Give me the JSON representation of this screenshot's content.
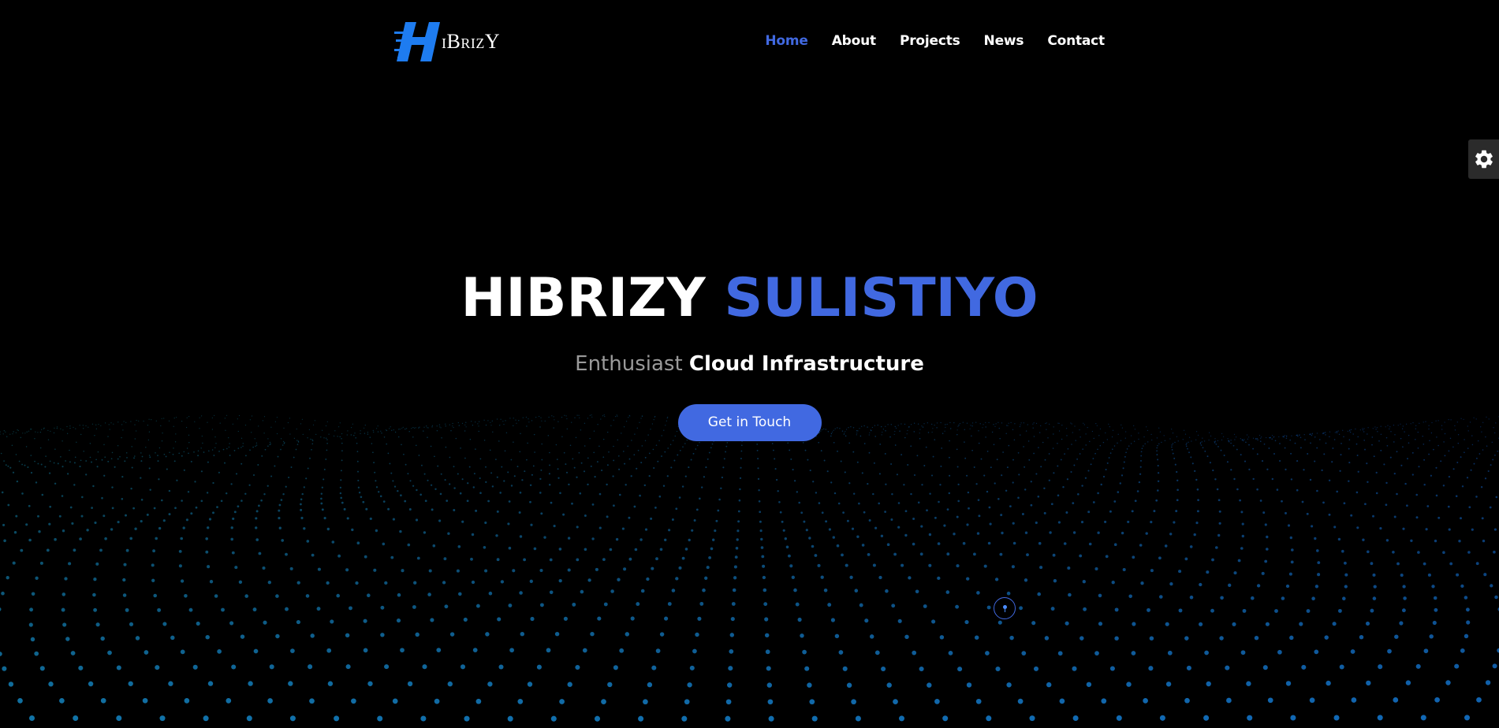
{
  "brand": {
    "logo_text": "iBrizY",
    "logo_letter": "H",
    "accent_color": "#4169e1"
  },
  "nav": {
    "items": [
      {
        "label": "Home",
        "active": true
      },
      {
        "label": "About",
        "active": false
      },
      {
        "label": "Projects",
        "active": false
      },
      {
        "label": "News",
        "active": false
      },
      {
        "label": "Contact",
        "active": false
      }
    ]
  },
  "hero": {
    "title_first": "HIBRIZY",
    "title_second": "SULISTIYO",
    "subtitle_muted": "Enthusiast",
    "subtitle_strong": "Cloud Infrastructure",
    "cta_label": "Get in Touch"
  },
  "settings": {
    "icon": "gear-icon"
  },
  "scroll": {
    "icon": "scroll-down-icon"
  },
  "colors": {
    "background": "#000000",
    "particle": "#1aa3b8",
    "particle_blue": "#1e7ad6"
  }
}
